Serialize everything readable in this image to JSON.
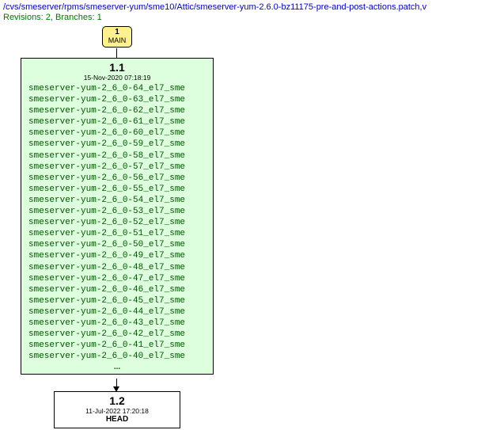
{
  "header": {
    "path": "/cvs/smeserver/rpms/smeserver-yum/sme10/Attic/smeserver-yum-2.6.0-bz11175-pre-and-post-actions.patch,v",
    "revisions_line": "Revisions: 2, Branches: 1"
  },
  "main_node": {
    "number": "1",
    "label": "MAIN"
  },
  "rev11": {
    "version": "1.1",
    "date": "15-Nov-2020 07:18:19",
    "tags": [
      "smeserver-yum-2_6_0-64_el7_sme",
      "smeserver-yum-2_6_0-63_el7_sme",
      "smeserver-yum-2_6_0-62_el7_sme",
      "smeserver-yum-2_6_0-61_el7_sme",
      "smeserver-yum-2_6_0-60_el7_sme",
      "smeserver-yum-2_6_0-59_el7_sme",
      "smeserver-yum-2_6_0-58_el7_sme",
      "smeserver-yum-2_6_0-57_el7_sme",
      "smeserver-yum-2_6_0-56_el7_sme",
      "smeserver-yum-2_6_0-55_el7_sme",
      "smeserver-yum-2_6_0-54_el7_sme",
      "smeserver-yum-2_6_0-53_el7_sme",
      "smeserver-yum-2_6_0-52_el7_sme",
      "smeserver-yum-2_6_0-51_el7_sme",
      "smeserver-yum-2_6_0-50_el7_sme",
      "smeserver-yum-2_6_0-49_el7_sme",
      "smeserver-yum-2_6_0-48_el7_sme",
      "smeserver-yum-2_6_0-47_el7_sme",
      "smeserver-yum-2_6_0-46_el7_sme",
      "smeserver-yum-2_6_0-45_el7_sme",
      "smeserver-yum-2_6_0-44_el7_sme",
      "smeserver-yum-2_6_0-43_el7_sme",
      "smeserver-yum-2_6_0-42_el7_sme",
      "smeserver-yum-2_6_0-41_el7_sme",
      "smeserver-yum-2_6_0-40_el7_sme"
    ],
    "ellipsis": "..."
  },
  "rev12": {
    "version": "1.2",
    "date": "11-Jul-2022 17:20:18",
    "head_label": "HEAD"
  }
}
